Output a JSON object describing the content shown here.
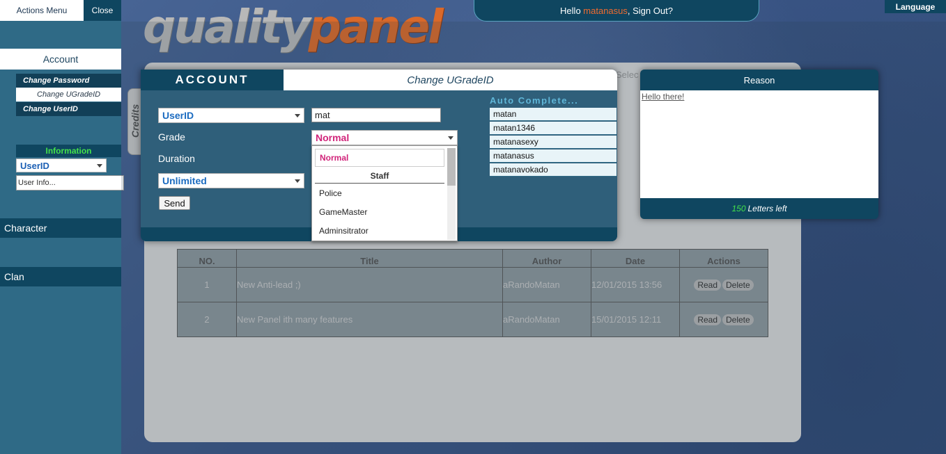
{
  "sidebar": {
    "actions_menu": "Actions Menu",
    "close": "Close",
    "account": "Account",
    "sub_items": [
      "Change Password",
      "Change UGradeID",
      "Change UserID"
    ],
    "info_title": "Information",
    "info_select": "UserID",
    "info_input_placeholder": "User Info...",
    "sections": [
      "Character",
      "Clan"
    ]
  },
  "header": {
    "logo_part1": "quality",
    "logo_part2": "panel",
    "hello_prefix": "Hello ",
    "username": "matanasus",
    "hello_suffix": ", Sign Out?",
    "language": "Language"
  },
  "background": {
    "credits_tab": "Credits",
    "select_peek": "Selec",
    "news_headers": [
      "NO.",
      "Title",
      "Author",
      "Date",
      "Actions"
    ],
    "news_rows": [
      {
        "no": "1",
        "title": "New Anti-lead ;)",
        "author": "aRandoMatan",
        "date": "12/01/2015 13:56"
      },
      {
        "no": "2",
        "title": "New Panel ith many features",
        "author": "aRandoMatan",
        "date": "15/01/2015 12:11"
      }
    ],
    "read_label": "Read",
    "delete_label": "Delete"
  },
  "modal": {
    "title": "ACCOUNT",
    "subtitle": "Change UGradeID",
    "id_type_select": "UserID",
    "search_value": "mat",
    "grade_label": "Grade",
    "duration_label": "Duration",
    "grade_value": "Normal",
    "duration_value": "Unlimited",
    "send_label": "Send",
    "grade_options": {
      "selected": "Normal",
      "group": "Staff",
      "items": [
        "Police",
        "GameMaster",
        "Adminsitrator"
      ]
    },
    "autocomplete_title": "Auto Complete...",
    "autocomplete_items": [
      "matan",
      "matan1346",
      "matanasexy",
      "matanasus",
      "matanavokado"
    ]
  },
  "reason": {
    "title": "Reason",
    "text": "Hello there!",
    "letters_left_count": "150",
    "letters_left_label": "Letters left"
  },
  "colors": {
    "sidebar_bg": "#2f6a86",
    "dark_teal": "#0f4660",
    "accent_orange": "#f26b2f",
    "green": "#44e24a",
    "grade_pink": "#d1247a",
    "select_blue": "#1b6bc0"
  }
}
